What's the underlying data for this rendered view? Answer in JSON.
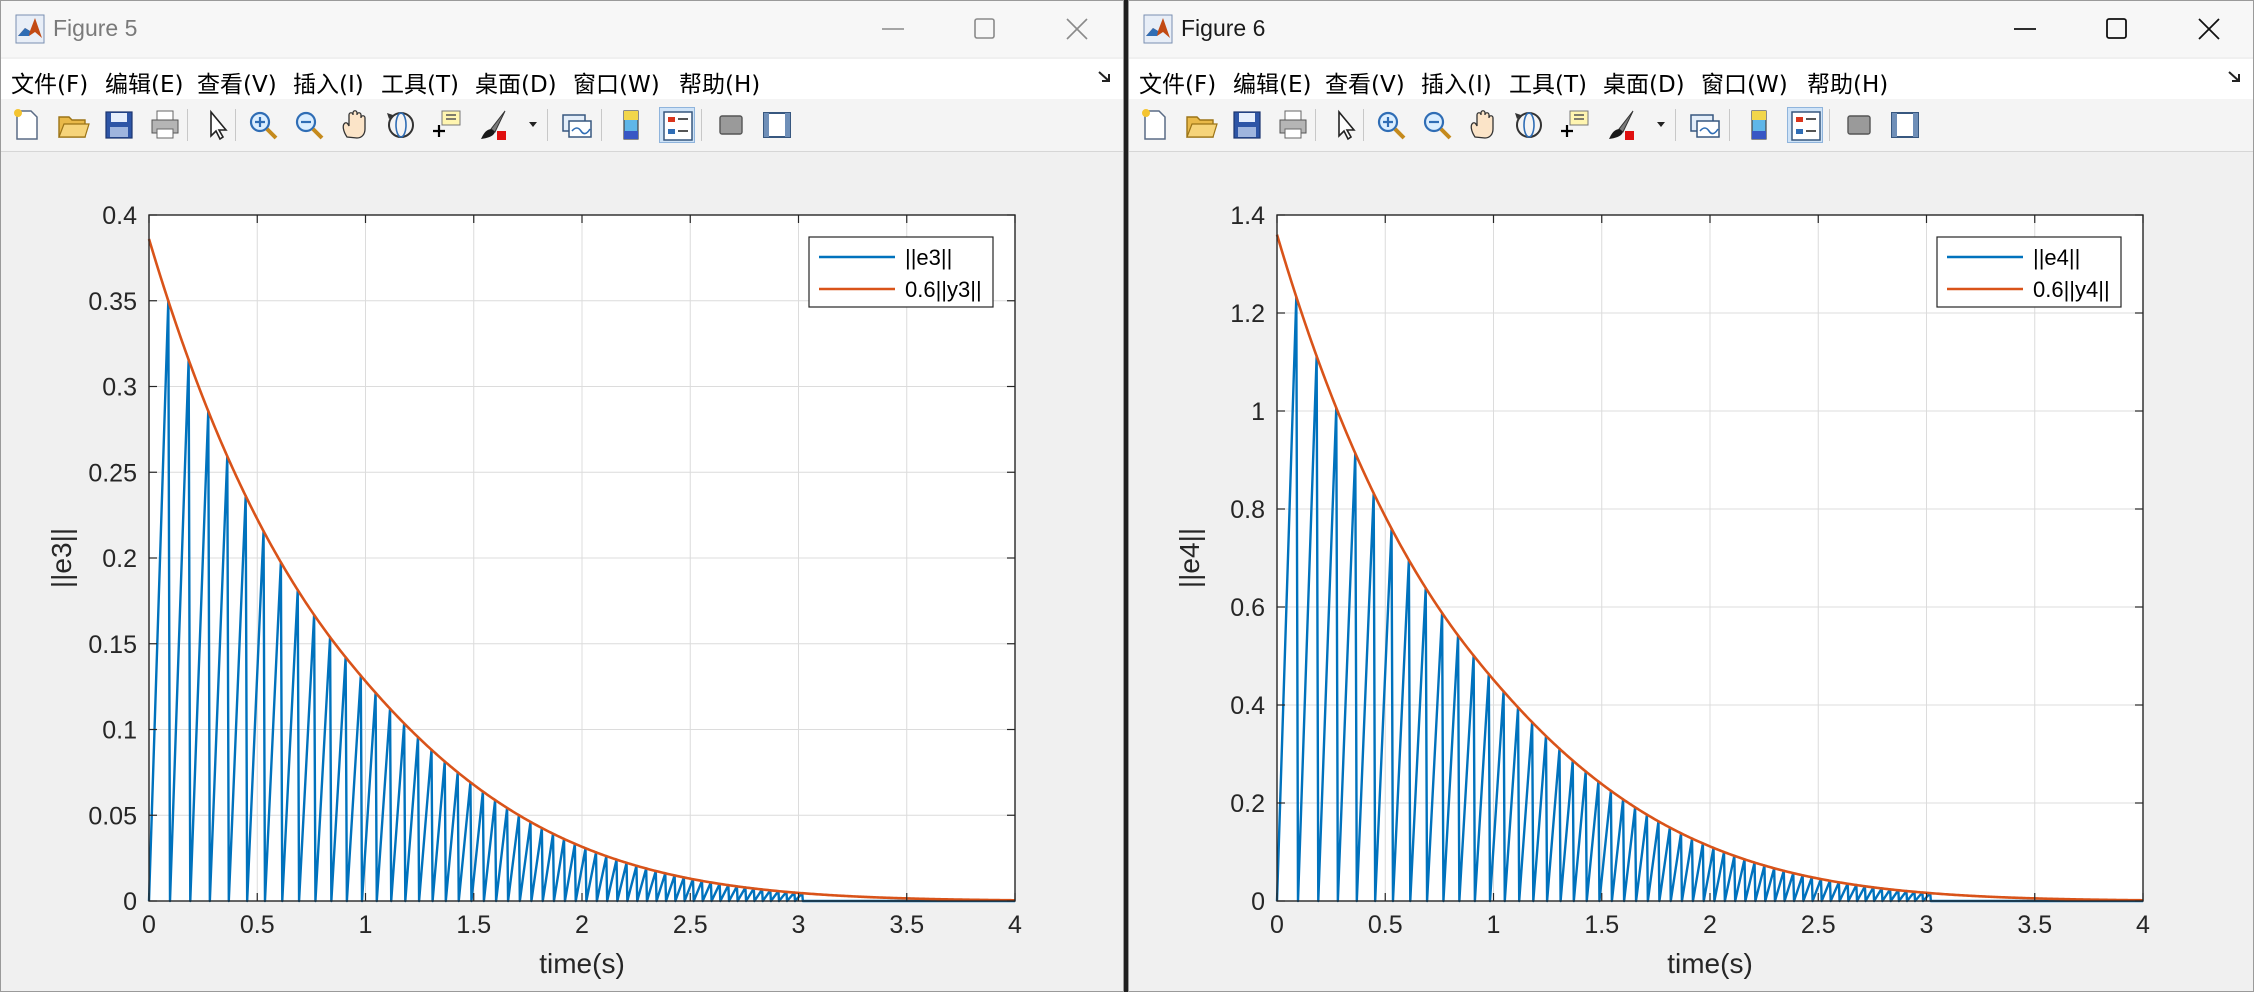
{
  "menu_items": [
    "文件(F)",
    "编辑(E)",
    "查看(V)",
    "插入(I)",
    "工具(T)",
    "桌面(D)",
    "窗口(W)",
    "帮助(H)"
  ],
  "toolbar_icons": [
    "new-figure-icon",
    "open-file-icon",
    "save-icon",
    "print-icon",
    "pointer-icon",
    "zoom-in-icon",
    "zoom-out-icon",
    "pan-hand-icon",
    "rotate-3d-icon",
    "data-cursor-icon",
    "brush-icon",
    "brush-dropdown-icon",
    "link-plot-icon",
    "colorbar-icon",
    "legend-icon",
    "hide-plot-tools-icon",
    "show-plot-tools-icon"
  ],
  "windows": [
    {
      "title": "Figure 5",
      "active": false,
      "chart_data": {
        "type": "line",
        "xlabel": "time(s)",
        "ylabel": "||e3||",
        "xlim": [
          0,
          4
        ],
        "ylim": [
          0,
          0.4
        ],
        "xticks": [
          0,
          0.5,
          1,
          1.5,
          2,
          2.5,
          3,
          3.5,
          4
        ],
        "xtick_labels": [
          "0",
          "0.5",
          "1",
          "1.5",
          "2",
          "2.5",
          "3",
          "3.5",
          "4"
        ],
        "yticks": [
          0,
          0.05,
          0.1,
          0.15,
          0.2,
          0.25,
          0.3,
          0.35,
          0.4
        ],
        "ytick_labels": [
          "0",
          "0.05",
          "0.1",
          "0.15",
          "0.2",
          "0.25",
          "0.3",
          "0.35",
          "0.4"
        ],
        "grid": true,
        "legend_position": "top-right",
        "envelope_start": 0.386,
        "series": [
          {
            "name": "||e3||",
            "color": "#0072BD",
            "kind": "sawtooth"
          },
          {
            "name": "0.6||y3||",
            "color": "#D95319",
            "kind": "envelope"
          }
        ]
      }
    },
    {
      "title": "Figure 6",
      "active": true,
      "chart_data": {
        "type": "line",
        "xlabel": "time(s)",
        "ylabel": "||e4||",
        "xlim": [
          0,
          4
        ],
        "ylim": [
          0,
          1.4
        ],
        "xticks": [
          0,
          0.5,
          1,
          1.5,
          2,
          2.5,
          3,
          3.5,
          4
        ],
        "xtick_labels": [
          "0",
          "0.5",
          "1",
          "1.5",
          "2",
          "2.5",
          "3",
          "3.5",
          "4"
        ],
        "yticks": [
          0,
          0.2,
          0.4,
          0.6,
          0.8,
          1,
          1.2,
          1.4
        ],
        "ytick_labels": [
          "0",
          "0.2",
          "0.4",
          "0.6",
          "0.8",
          "1",
          "1.2",
          "1.4"
        ],
        "grid": true,
        "legend_position": "top-right",
        "envelope_start": 1.36,
        "series": [
          {
            "name": "||e4||",
            "color": "#0072BD",
            "kind": "sawtooth"
          },
          {
            "name": "0.6||y4||",
            "color": "#D95319",
            "kind": "envelope"
          }
        ]
      }
    }
  ]
}
